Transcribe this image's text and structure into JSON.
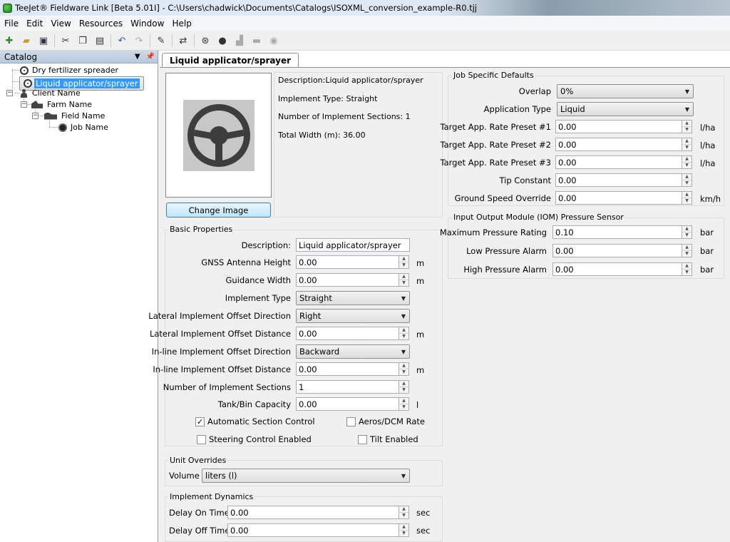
{
  "window": {
    "title": "TeeJet® Fieldware Link [Beta 5.01I] - C:\\Users\\chadwick\\Documents\\Catalogs\\ISOXML_conversion_example-R0.tjj"
  },
  "menu": [
    "File",
    "Edit",
    "View",
    "Resources",
    "Window",
    "Help"
  ],
  "toolbar": {
    "icons": [
      "new-icon",
      "open-icon",
      "save-icon",
      "cut-icon",
      "copy-icon",
      "paste-icon",
      "undo-icon",
      "redo-icon",
      "edit-icon",
      "transfer-icon",
      "implement-icon",
      "client-icon",
      "farm-icon",
      "field-icon",
      "job-icon"
    ]
  },
  "catalog": {
    "title": "Catalog",
    "items": [
      {
        "label": "Dry fertilizer spreader",
        "icon": "steering-wheel-icon"
      },
      {
        "label": "Liquid applicator/sprayer",
        "icon": "steering-wheel-icon",
        "selected": true
      },
      {
        "label": "Client Name",
        "icon": "person-icon"
      },
      {
        "label": "Farm Name",
        "icon": "farm-icon"
      },
      {
        "label": "Field Name",
        "icon": "field-icon"
      },
      {
        "label": "Job Name",
        "icon": "job-icon"
      }
    ]
  },
  "tab": {
    "label": "Liquid applicator/sprayer"
  },
  "summary": {
    "description": "Description:Liquid applicator/sprayer",
    "implement_type": "Implement Type: Straight",
    "sections": "Number of Implement Sections: 1",
    "width": "Total Width (m): 36.00",
    "change_image": "Change Image"
  },
  "basic": {
    "title": "Basic Properties",
    "description_label": "Description:",
    "description_value": "Liquid applicator/sprayer",
    "gnss_label": "GNSS Antenna Height",
    "gnss_value": "0.00",
    "gnss_unit": "m",
    "guidance_label": "Guidance Width",
    "guidance_value": "0.00",
    "guidance_unit": "m",
    "type_label": "Implement Type",
    "type_value": "Straight",
    "lat_dir_label": "Lateral Implement Offset Direction",
    "lat_dir_value": "Right",
    "lat_dist_label": "Lateral Implement Offset Distance",
    "lat_dist_value": "0.00",
    "lat_dist_unit": "m",
    "inl_dir_label": "In-line Implement Offset Direction",
    "inl_dir_value": "Backward",
    "inl_dist_label": "In-line Implement Offset Distance",
    "inl_dist_value": "0.00",
    "inl_dist_unit": "m",
    "sections_label": "Number of Implement Sections",
    "sections_value": "1",
    "tank_label": "Tank/Bin Capacity",
    "tank_value": "0.00",
    "tank_unit": "l",
    "auto_section": "Automatic Section Control",
    "auto_section_checked": true,
    "aeros": "Aeros/DCM  Rate",
    "aeros_checked": false,
    "steering": "Steering Control Enabled",
    "steering_checked": false,
    "tilt": "Tilt Enabled",
    "tilt_checked": false
  },
  "unit_overrides": {
    "title": "Unit Overrides",
    "volume_label": "Volume",
    "volume_value": "liters  (l)"
  },
  "dynamics": {
    "title": "Implement Dynamics",
    "delay_on_label": "Delay On Time",
    "delay_on_value": "0.00",
    "delay_on_unit": "sec",
    "delay_off_label": "Delay Off Time",
    "delay_off_value": "0.00",
    "delay_off_unit": "sec"
  },
  "job_defaults": {
    "title": "Job Specific Defaults",
    "overlap_label": "Overlap",
    "overlap_value": "0%",
    "app_type_label": "Application Type",
    "app_type_value": "Liquid",
    "p1_label": "Target App. Rate Preset #1",
    "p1_value": "0.00",
    "p1_unit": "l/ha",
    "p2_label": "Target App. Rate Preset #2",
    "p2_value": "0.00",
    "p2_unit": "l/ha",
    "p3_label": "Target App. Rate Preset #3",
    "p3_value": "0.00",
    "p3_unit": "l/ha",
    "tip_label": "Tip Constant",
    "tip_value": "0.00",
    "ground_label": "Ground Speed Override",
    "ground_value": "0.00",
    "ground_unit": "km/h"
  },
  "iom": {
    "title": "Input Output Module (IOM) Pressure Sensor",
    "max_label": "Maximum Pressure Rating",
    "max_value": "0.10",
    "max_unit": "bar",
    "low_label": "Low Pressure Alarm",
    "low_value": "0.00",
    "low_unit": "bar",
    "high_label": "High Pressure Alarm",
    "high_value": "0.00",
    "high_unit": "bar"
  }
}
